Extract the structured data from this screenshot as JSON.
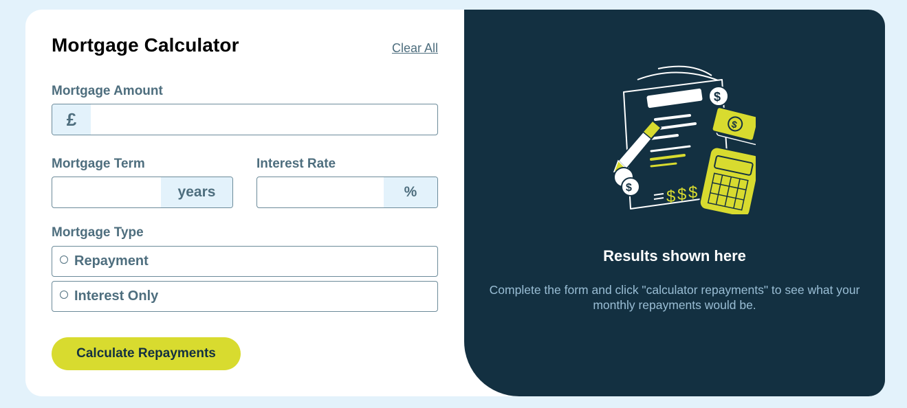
{
  "form": {
    "title": "Mortgage Calculator",
    "clear_all_label": "Clear All",
    "amount": {
      "label": "Mortgage Amount",
      "prefix": "£",
      "value": ""
    },
    "term": {
      "label": "Mortgage Term",
      "suffix": "years",
      "value": ""
    },
    "rate": {
      "label": "Interest Rate",
      "suffix": "%",
      "value": ""
    },
    "type": {
      "label": "Mortgage Type",
      "options": [
        {
          "label": "Repayment",
          "selected": false
        },
        {
          "label": "Interest Only",
          "selected": false
        }
      ]
    },
    "submit_label": "Calculate Repayments"
  },
  "results": {
    "title": "Results shown here",
    "description": "Complete the form and click \"calculator repayments\" to see what your monthly repayments would be.",
    "illustration_icon": "calculator-document-illustration"
  },
  "colors": {
    "background": "#e3f2fb",
    "panel_dark": "#133041",
    "accent_lime": "#d8db2f",
    "label_slate": "#4e6e7e",
    "muted_text": "#9abed5"
  }
}
